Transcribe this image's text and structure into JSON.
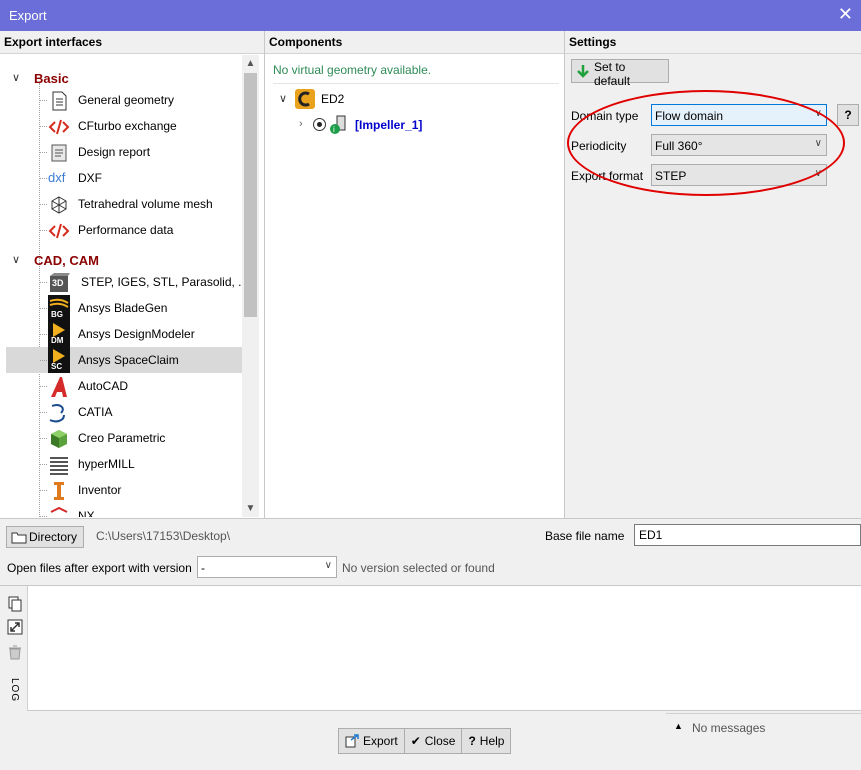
{
  "window": {
    "title": "Export",
    "close_glyph": "✕"
  },
  "left_panel": {
    "header": "Export interfaces",
    "categories": [
      {
        "label": "Basic",
        "items": [
          {
            "label": "General geometry",
            "icon": "document-icon"
          },
          {
            "label": "CFturbo exchange",
            "icon": "code-icon"
          },
          {
            "label": "Design report",
            "icon": "report-icon"
          },
          {
            "label": "DXF",
            "icon": "dxf-icon"
          },
          {
            "label": "Tetrahedral volume mesh",
            "icon": "mesh-icon"
          },
          {
            "label": "Performance data",
            "icon": "code-icon"
          }
        ]
      },
      {
        "label": "CAD, CAM",
        "items": [
          {
            "label": "STEP, IGES, STL, Parasolid, ...",
            "icon": "3d-icon"
          },
          {
            "label": "Ansys BladeGen",
            "icon": "ansys-bg-icon"
          },
          {
            "label": "Ansys DesignModeler",
            "icon": "ansys-dm-icon"
          },
          {
            "label": "Ansys SpaceClaim",
            "icon": "ansys-sc-icon",
            "selected": true
          },
          {
            "label": "AutoCAD",
            "icon": "autocad-icon"
          },
          {
            "label": "CATIA",
            "icon": "catia-icon"
          },
          {
            "label": "Creo Parametric",
            "icon": "creo-icon"
          },
          {
            "label": "hyperMILL",
            "icon": "hypermill-icon"
          },
          {
            "label": "Inventor",
            "icon": "inventor-icon"
          },
          {
            "label": "NX",
            "icon": "nx-icon"
          }
        ]
      }
    ],
    "icon_text": {
      "dxf": "dxf",
      "threed": "3D",
      "bg": "BG",
      "dm": "DM",
      "sc": "SC"
    }
  },
  "middle_panel": {
    "header": "Components",
    "message": "No virtual geometry available.",
    "root": "ED2",
    "child": "[Impeller_1]"
  },
  "right_panel": {
    "header": "Settings",
    "set_default_label": "Set to default",
    "domain_type_label": "Domain type",
    "domain_type_value": "Flow domain",
    "periodicity_label": "Periodicity",
    "periodicity_value": "Full 360°",
    "export_format_label": "Export format",
    "export_format_value": "STEP",
    "help_label": "?",
    "highlight_color": "#e00000"
  },
  "bottom": {
    "directory_button": "Directory",
    "directory_path": "C:\\Users\\17153\\Desktop\\",
    "base_file_name_label": "Base file name",
    "base_file_name_value": "ED1",
    "open_files_label": "Open files after export with version",
    "version_value": "-",
    "version_status": "No version selected or found"
  },
  "log": {
    "label": "LOG",
    "status": "No messages"
  },
  "footer": {
    "export_label": "Export",
    "close_label": "Close",
    "help_label": "Help"
  }
}
